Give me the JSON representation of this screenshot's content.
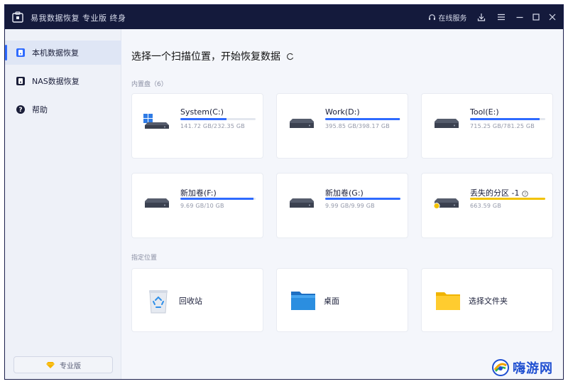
{
  "titlebar": {
    "app_title": "易我数据恢复 专业版 终身",
    "online_service": "在线服务"
  },
  "sidebar": {
    "items": [
      {
        "label": "本机数据恢复",
        "active": true
      },
      {
        "label": "NAS数据恢复",
        "active": false
      },
      {
        "label": "帮助",
        "active": false
      }
    ],
    "pro_button": "专业版"
  },
  "main": {
    "title": "选择一个扫描位置，开始恢复数据",
    "internal_label": "内置盘（6）",
    "location_label": "指定位置",
    "drives": [
      {
        "name": "System(C:)",
        "size": "141.72 GB/232.35 GB",
        "used_fraction": 0.61,
        "system": true
      },
      {
        "name": "Work(D:)",
        "size": "395.85 GB/398.17 GB",
        "used_fraction": 0.99
      },
      {
        "name": "Tool(E:)",
        "size": "715.25 GB/781.25 GB",
        "used_fraction": 0.92
      },
      {
        "name": "新加卷(F:)",
        "size": "9.69 GB/10 GB",
        "used_fraction": 0.97
      },
      {
        "name": "新加卷(G:)",
        "size": "9.99 GB/9.99 GB",
        "used_fraction": 1.0
      },
      {
        "name": "丢失的分区 -1",
        "size": "663.59 GB",
        "used_fraction": 1.0,
        "lost": true
      }
    ],
    "locations": [
      {
        "name": "回收站",
        "icon": "recycle-bin-icon"
      },
      {
        "name": "桌面",
        "icon": "desktop-icon"
      },
      {
        "name": "选择文件夹",
        "icon": "folder-icon"
      }
    ]
  },
  "colors": {
    "titlebar": "#141a3c",
    "accent": "#2f6bff",
    "lost_partition": "#f2c200"
  },
  "watermark": {
    "text": "嗨游网"
  }
}
